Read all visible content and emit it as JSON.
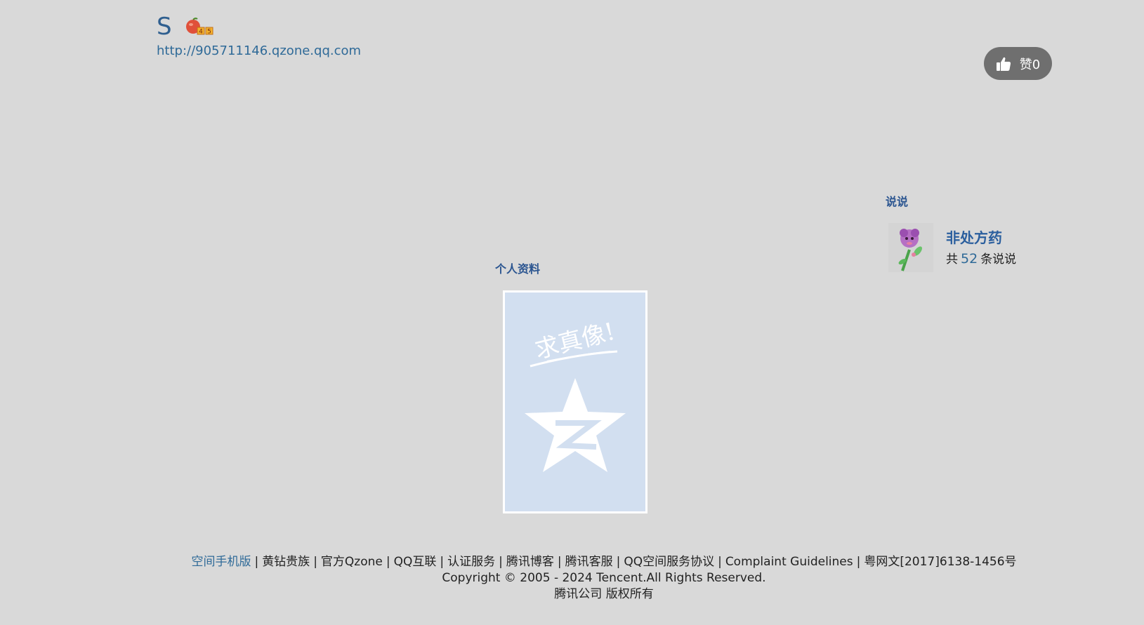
{
  "header": {
    "owner_name": "S",
    "space_url": "http://905711146.qzone.qq.com",
    "vip_level": "5",
    "like_label": "赞0"
  },
  "shuoshuo": {
    "title": "说说",
    "name": "非处方药",
    "count_prefix": "共",
    "count": "52",
    "count_suffix": "条说说"
  },
  "profile": {
    "title": "个人资料",
    "photo_caption": "求真像!"
  },
  "footer": {
    "links": [
      "空间手机版",
      "黄钻贵族",
      "官方Qzone",
      "QQ互联",
      "认证服务",
      "腾讯博客",
      "腾讯客服",
      "QQ空间服务协议",
      "Complaint Guidelines",
      "粤网文[2017]6138-1456号"
    ],
    "copyright": "Copyright © 2005 - 2024 Tencent.All Rights Reserved.",
    "company": "腾讯公司 版权所有"
  },
  "colors": {
    "background": "#d9d9d9",
    "link_blue": "#2f6a98",
    "title_blue": "#2b5590",
    "like_button": "#6f6f6f",
    "photo_bg": "#d2dff0"
  }
}
